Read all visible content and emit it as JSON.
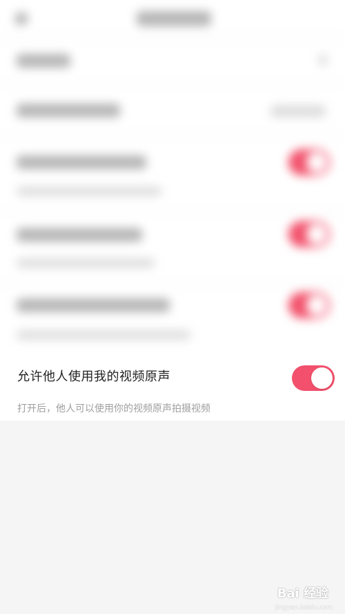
{
  "setting": {
    "title": "允许他人使用我的视频原声",
    "description": "打开后，他人可以使用你的视频原声拍摄视频",
    "toggle_state": "on",
    "toggle_color": "#f2506c"
  },
  "watermark": {
    "text": "Bai 经验",
    "subtext": "jingyan.baidu.com"
  }
}
